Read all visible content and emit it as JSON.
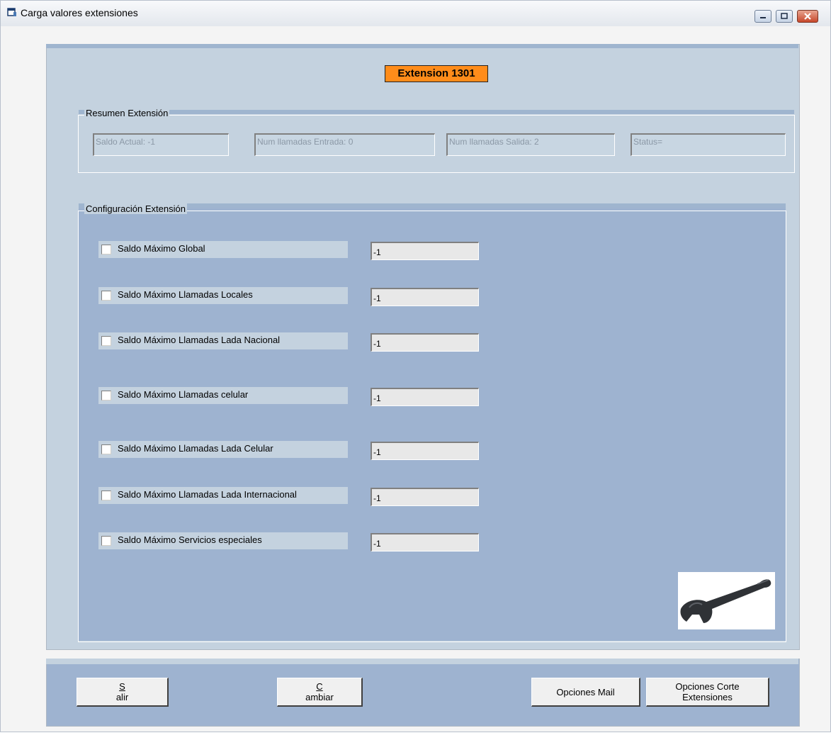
{
  "window": {
    "title": "Carga valores extensiones"
  },
  "extension_label": "Extension 1301",
  "resumen": {
    "legend": "Resumen Extensión",
    "fields": [
      "Saldo Actual: -1",
      "Num llamadas Entrada: 0",
      "Num llamadas Salida: 2",
      "Status="
    ]
  },
  "configuracion": {
    "legend": "Configuración  Extensión",
    "rows": [
      {
        "label": "Saldo Máximo Global",
        "value": "-1",
        "checked": false
      },
      {
        "label": "Saldo Máximo Llamadas Locales",
        "value": "-1",
        "checked": false
      },
      {
        "label": "Saldo Máximo Llamadas Lada Nacional",
        "value": "-1",
        "checked": false
      },
      {
        "label": "Saldo Máximo Llamadas celular",
        "value": "-1",
        "checked": false
      },
      {
        "label": "Saldo Máximo Llamadas Lada Celular",
        "value": "-1",
        "checked": false
      },
      {
        "label": "Saldo Máximo Llamadas Lada Internacional",
        "value": "-1",
        "checked": false
      },
      {
        "label": "Saldo Máximo Servicios especiales",
        "value": "-1",
        "checked": false
      }
    ]
  },
  "buttons": {
    "salir_first": "S",
    "salir_rest": "alir",
    "cambiar_first": "C",
    "cambiar_rest": "ambiar",
    "opciones_mail": "Opciones Mail",
    "opciones_corte_line1": "Opciones Corte",
    "opciones_corte_line2": "Extensiones"
  },
  "icons": {
    "app": "form-icon",
    "tool": "wrench-icon"
  },
  "colors": {
    "extension_label_bg": "#ff8c1a",
    "panel_light": "#c4d2df",
    "panel_dark": "#9eb3d0"
  }
}
